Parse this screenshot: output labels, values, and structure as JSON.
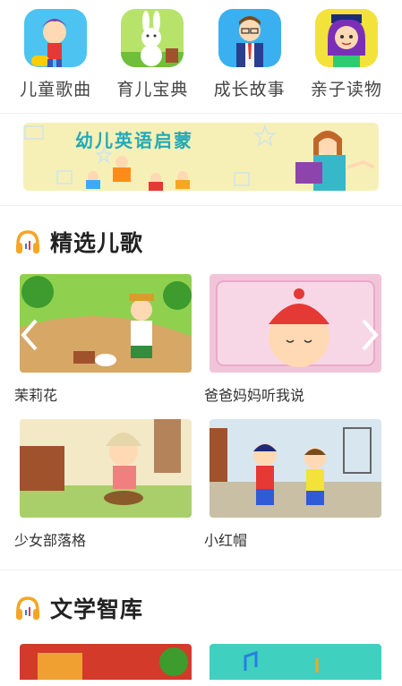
{
  "categories": [
    {
      "label": "儿童歌曲",
      "icon": "cartoon-child-icon"
    },
    {
      "label": "育儿宝典",
      "icon": "rabbit-icon"
    },
    {
      "label": "成长故事",
      "icon": "teacher-icon"
    },
    {
      "label": "亲子读物",
      "icon": "girl-icon"
    }
  ],
  "banner": {
    "text": "幼儿英语启蒙"
  },
  "section1": {
    "title": "精选儿歌",
    "items": [
      {
        "caption": "茉莉花"
      },
      {
        "caption": "爸爸妈妈听我说"
      },
      {
        "caption": "少女部落格"
      },
      {
        "caption": "小红帽"
      }
    ]
  },
  "section2": {
    "title": "文学智库"
  },
  "colors": {
    "accent": "#f5a623",
    "divider": "#eeeeee"
  }
}
